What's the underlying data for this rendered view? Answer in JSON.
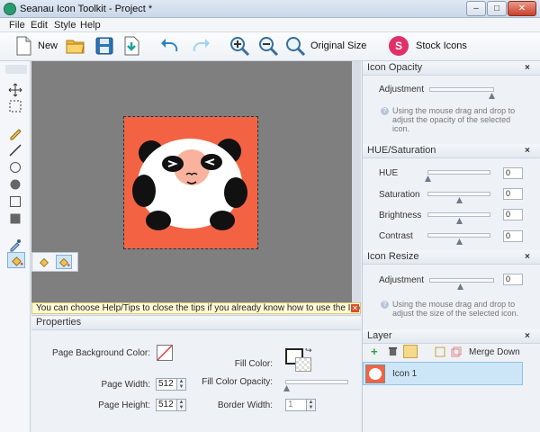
{
  "window": {
    "title": "Seanau Icon Toolkit - Project *",
    "controls": [
      "–",
      "□",
      "✕"
    ]
  },
  "menu": [
    "File",
    "Edit",
    "Style",
    "Help"
  ],
  "toolbar": {
    "new_label": "New",
    "original_size_label": "Original Size",
    "stock_icons_label": "Stock Icons",
    "stock_badge": "S"
  },
  "tip": {
    "text": "You can choose Help/Tips to close the tips if you already know how to use the Icon Toolkit.",
    "close": "✕"
  },
  "properties": {
    "title": "Properties",
    "page_background_color_label": "Page Background Color:",
    "page_width_label": "Page Width:",
    "page_width_value": "512",
    "page_height_label": "Page Height:",
    "page_height_value": "512",
    "fill_color_label": "Fill Color:",
    "fill_color_opacity_label": "Fill Color Opacity:",
    "border_width_label": "Border Width:",
    "border_width_value": "1"
  },
  "icon_opacity": {
    "title": "Icon Opacity",
    "adjustment_label": "Adjustment",
    "hint": "Using the mouse drag and drop to adjust the opacity of the selected icon.",
    "close": "×"
  },
  "hue_saturation": {
    "title": "HUE/Saturation",
    "close": "×",
    "rows": [
      {
        "label": "HUE",
        "value": "0"
      },
      {
        "label": "Saturation",
        "value": "0"
      },
      {
        "label": "Brightness",
        "value": "0"
      },
      {
        "label": "Contrast",
        "value": "0"
      }
    ]
  },
  "icon_resize": {
    "title": "Icon Resize",
    "adjustment_label": "Adjustment",
    "value": "0",
    "hint": "Using the mouse drag and drop to adjust the size of the selected icon.",
    "close": "×"
  },
  "layer": {
    "title": "Layer",
    "merge_down_label": "Merge Down",
    "close": "×",
    "items": [
      {
        "name": "Icon 1"
      }
    ]
  },
  "colors": {
    "canvas_bg": "#7f7f7f",
    "art_bg": "#f36343",
    "accent_pink": "#e0306a",
    "selection": "#cde6f7"
  }
}
